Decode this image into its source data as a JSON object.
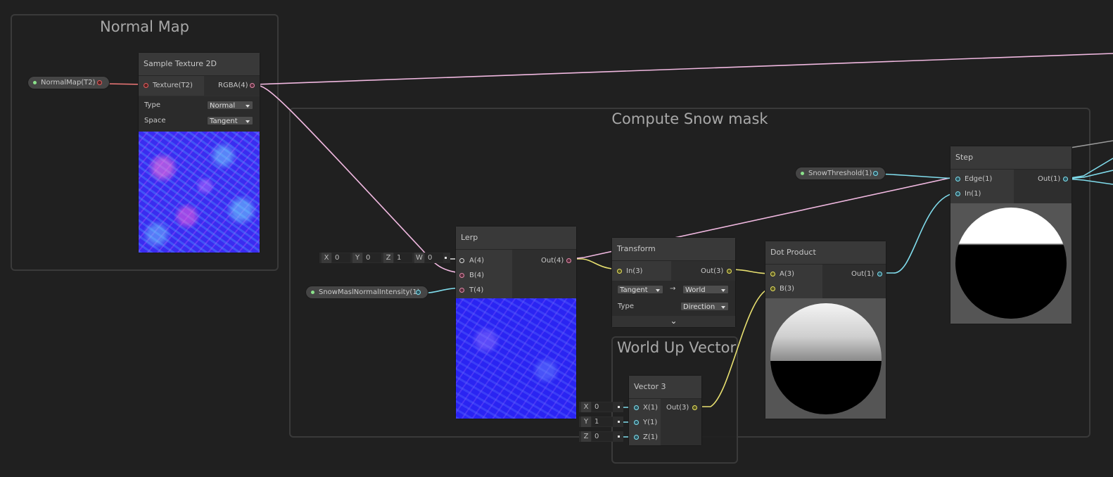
{
  "groups": {
    "normal_map": "Normal Map",
    "compute_snow_mask": "Compute Snow mask",
    "world_up_vector": "World Up Vector"
  },
  "properties": {
    "normal_map": "NormalMap(T2)",
    "snow_threshold": "SnowThreshold(1)",
    "snow_mask_normal_intensity": "SnowMaslNormalIntensity(1)"
  },
  "nodes": {
    "sample_texture": {
      "title": "Sample Texture 2D",
      "input": "Texture(T2)",
      "output": "RGBA(4)",
      "type_label": "Type",
      "type_value": "Normal",
      "space_label": "Space",
      "space_value": "Tangent"
    },
    "lerp": {
      "title": "Lerp",
      "inputs": [
        "A(4)",
        "B(4)",
        "T(4)"
      ],
      "output": "Out(4)",
      "a_default": {
        "x_label": "X",
        "x": "0",
        "y_label": "Y",
        "y": "0",
        "z_label": "Z",
        "z": "1",
        "w_label": "W",
        "w": "0"
      }
    },
    "transform": {
      "title": "Transform",
      "input": "In(3)",
      "output": "Out(3)",
      "from": "Tangent",
      "arrow": "→",
      "to": "World",
      "type_label": "Type",
      "type_value": "Direction",
      "expand": "⌄"
    },
    "dot_product": {
      "title": "Dot Product",
      "inputs": [
        "A(3)",
        "B(3)"
      ],
      "output": "Out(1)"
    },
    "step": {
      "title": "Step",
      "inputs": [
        "Edge(1)",
        "In(1)"
      ],
      "output": "Out(1)"
    },
    "vector3": {
      "title": "Vector 3",
      "inputs": [
        "X(1)",
        "Y(1)",
        "Z(1)"
      ],
      "output": "Out(3)",
      "defaults": [
        {
          "label": "X",
          "value": "0"
        },
        {
          "label": "Y",
          "value": "1"
        },
        {
          "label": "Z",
          "value": "0"
        }
      ]
    }
  },
  "colors": {
    "background": "#202020",
    "wire_vector4": "#f0b8e0",
    "wire_float": "#80dcec",
    "wire_vector3": "#e8e070",
    "wire_texture": "#f07878"
  }
}
